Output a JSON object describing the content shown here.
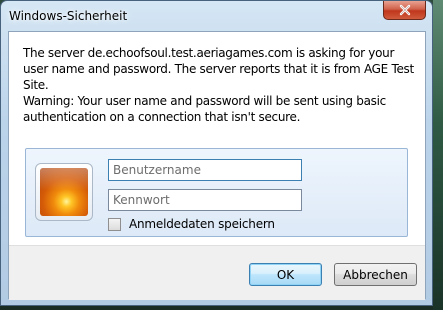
{
  "window": {
    "title": "Windows-Sicherheit"
  },
  "message": {
    "line1": "The server de.echoofsoul.test.aeriagames.com is asking for your user name and password. The server reports that it is from AGE Test Site.",
    "warning": "Warning: Your user name and password will be sent using basic authentication on a connection that isn't secure."
  },
  "credentials": {
    "username_placeholder": "Benutzername",
    "password_placeholder": "Kennwort",
    "remember_label": "Anmeldedaten speichern",
    "remember_checked": false
  },
  "buttons": {
    "ok_label": "OK",
    "cancel_label": "Abbrechen"
  },
  "icons": {
    "close": "close-icon",
    "user_tile": "flower-avatar-icon"
  }
}
